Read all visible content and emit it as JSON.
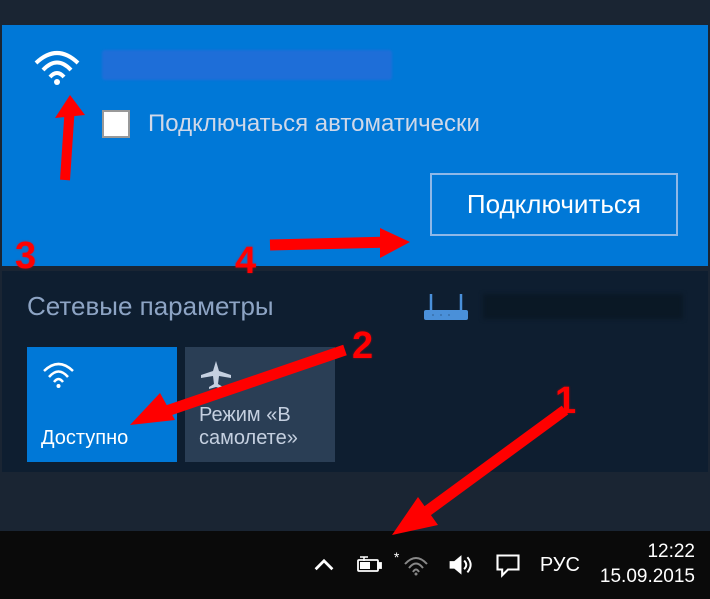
{
  "network": {
    "auto_connect_label": "Подключаться автоматически",
    "connect_button": "Подключиться"
  },
  "settings": {
    "title": "Сетевые параметры"
  },
  "tiles": {
    "wifi_label": "Доступно",
    "airplane_label": "Режим «В самолете»"
  },
  "taskbar": {
    "language": "РУС",
    "time": "12:22",
    "date": "15.09.2015"
  },
  "annotations": {
    "n1": "1",
    "n2": "2",
    "n3": "3",
    "n4": "4"
  }
}
